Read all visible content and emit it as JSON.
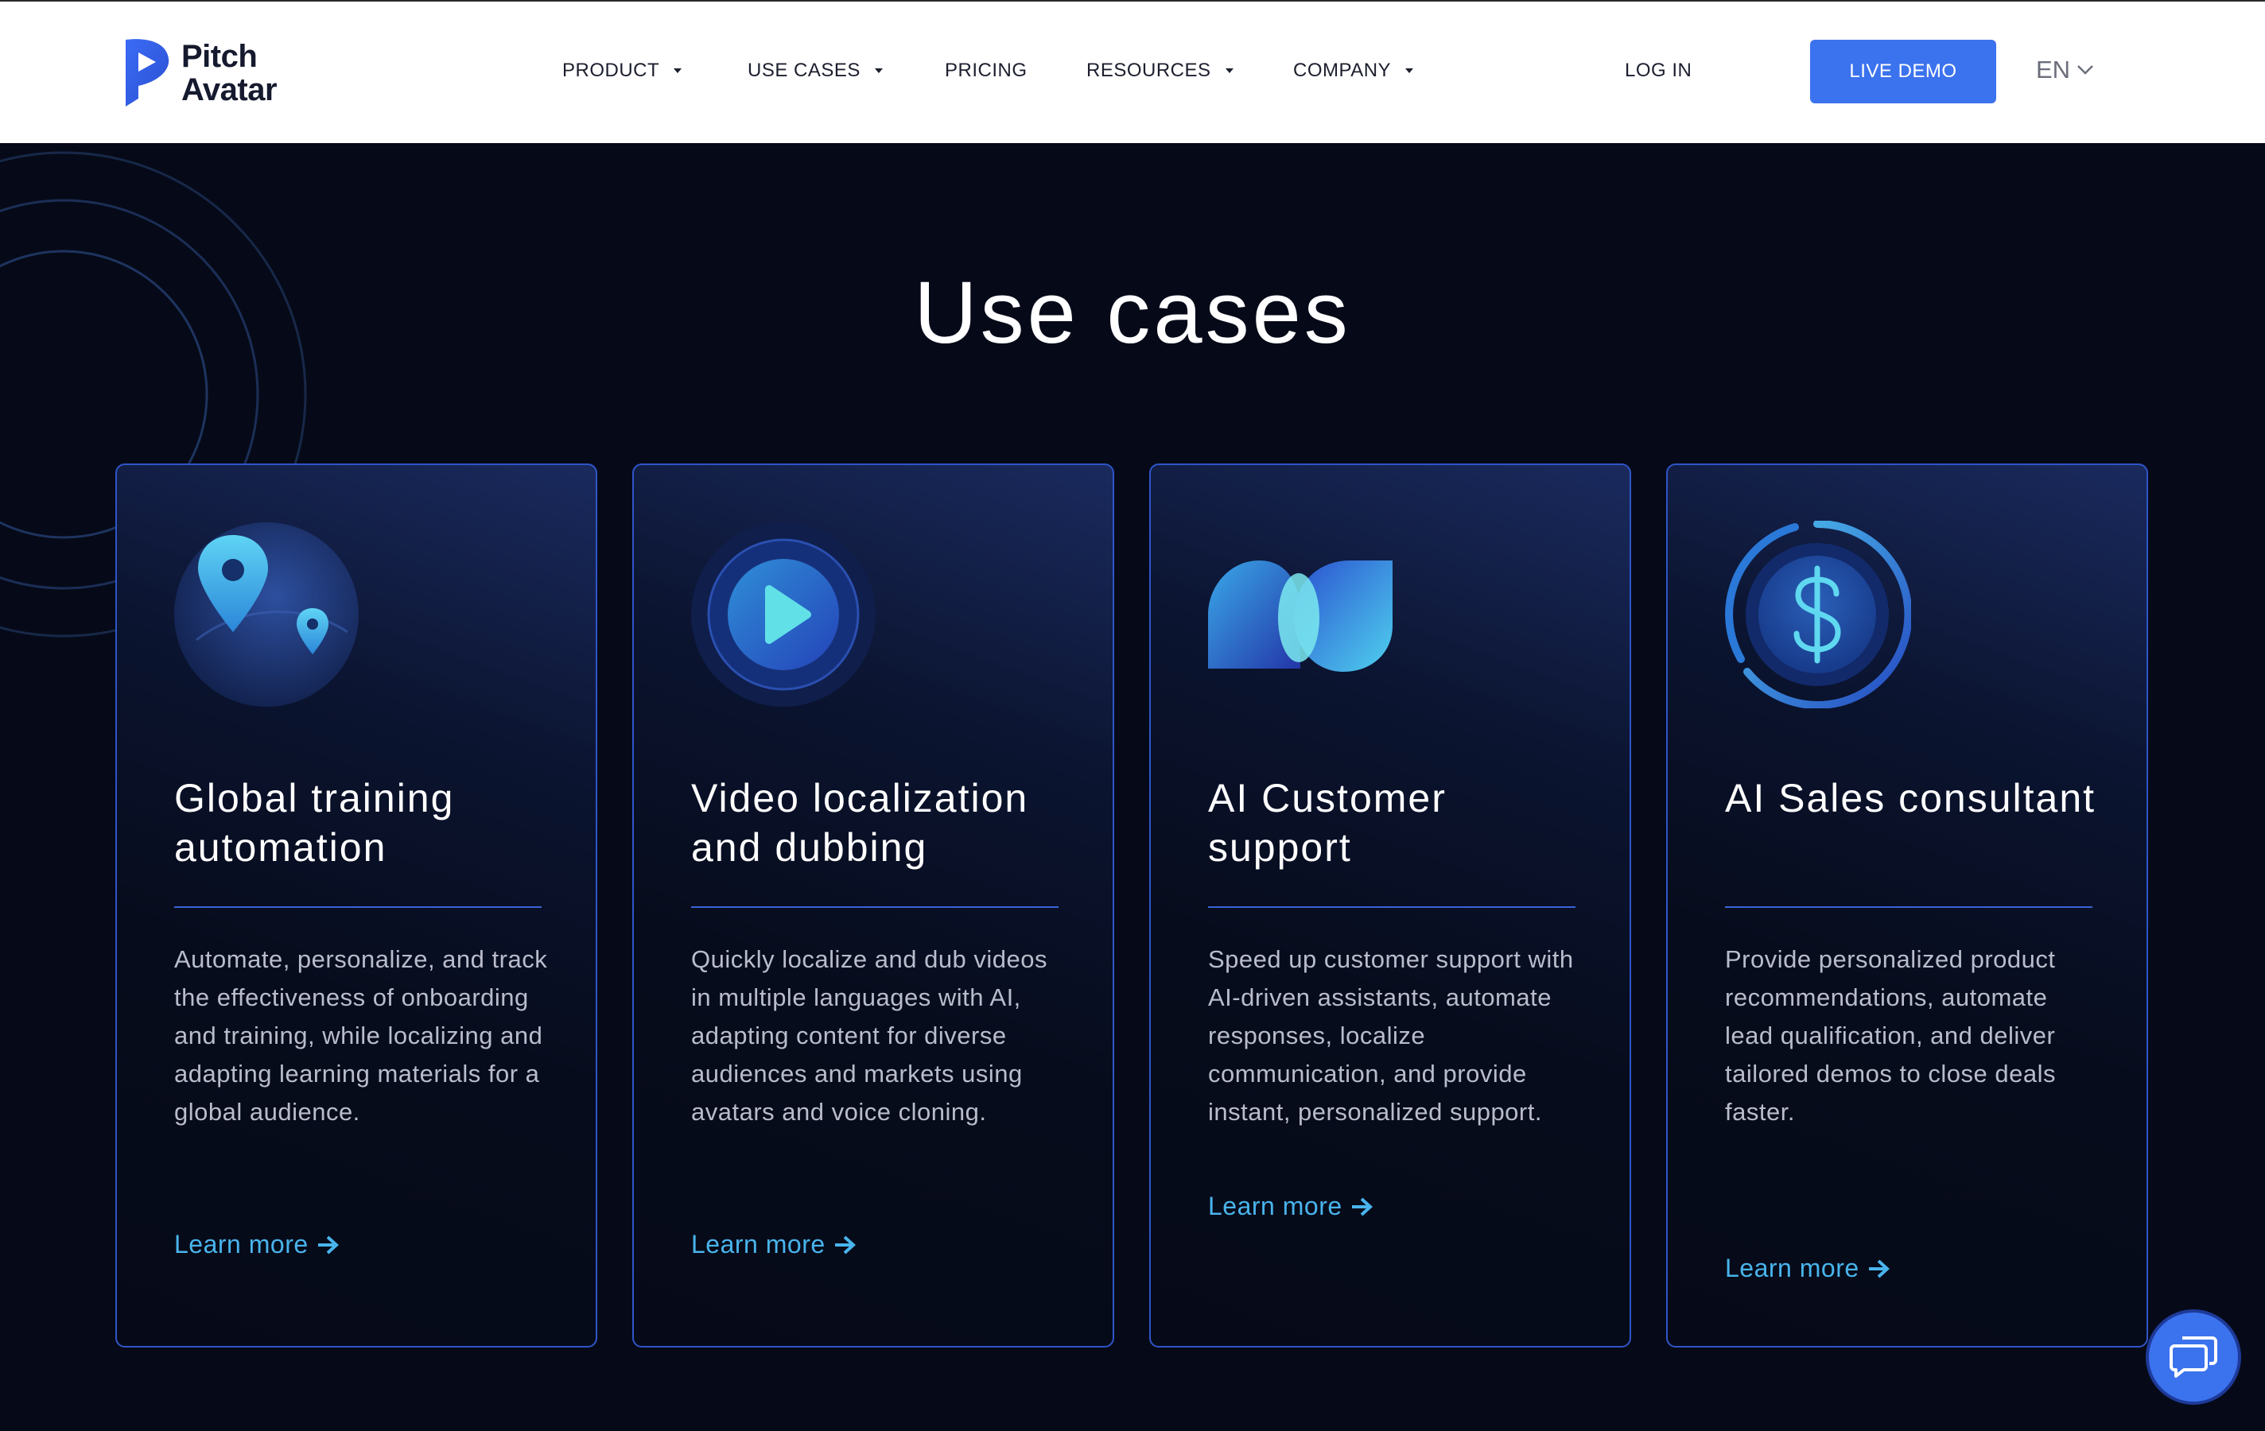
{
  "brand": {
    "line1": "Pitch",
    "line2": "Avatar"
  },
  "nav": {
    "product": "PRODUCT",
    "use_cases": "USE CASES",
    "pricing": "PRICING",
    "resources": "RESOURCES",
    "company": "COMPANY",
    "login": "LOG IN",
    "live_demo": "LIVE DEMO",
    "language": "EN"
  },
  "section": {
    "title": "Use cases"
  },
  "cards": [
    {
      "title": "Global training automation",
      "description": "Automate, personalize, and track the effectiveness of onboarding and training, while localizing and adapting learning materials for a global audience.",
      "link": "Learn more",
      "icon": "globe-pin-icon"
    },
    {
      "title": "Video localization and dubbing",
      "description": "Quickly localize and dub videos in multiple languages with AI, adapting content for diverse audiences and markets using avatars and voice cloning.",
      "link": "Learn more",
      "icon": "play-icon"
    },
    {
      "title": "AI Customer support",
      "description": "Speed up customer support with AI-driven assistants, automate responses, localize communication, and provide instant, personalized support.",
      "link": "Learn more",
      "icon": "chat-shapes-icon"
    },
    {
      "title": "AI Sales consultant",
      "description": "Provide personalized product recommendations, automate lead qualification, and deliver tailored demos to close deals faster.",
      "link": "Learn more",
      "icon": "dollar-coin-icon"
    }
  ],
  "colors": {
    "background": "#060a18",
    "accent": "#3b72ee",
    "link": "#49b4ec",
    "card_border": "#2f55c8"
  }
}
